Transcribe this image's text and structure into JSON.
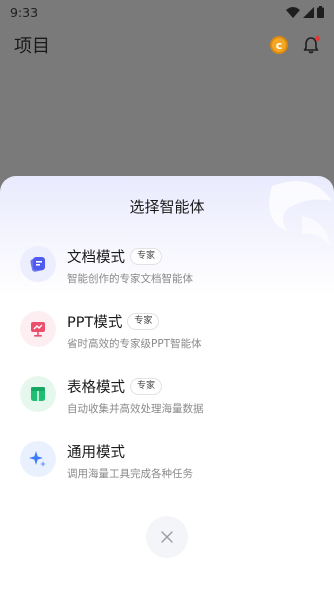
{
  "status_bar": {
    "time": "9:33"
  },
  "app_header": {
    "title": "项目"
  },
  "sheet": {
    "title": "选择智能体",
    "options": [
      {
        "name": "文档模式",
        "badge": "专家",
        "description": "智能创作的专家文档智能体",
        "icon": "document-icon"
      },
      {
        "name": "PPT模式",
        "badge": "专家",
        "description": "省时高效的专家级PPT智能体",
        "icon": "presentation-icon"
      },
      {
        "name": "表格模式",
        "badge": "专家",
        "description": "自动收集并高效处理海量数据",
        "icon": "table-icon"
      },
      {
        "name": "通用模式",
        "badge": "",
        "description": "调用海量工具完成各种任务",
        "icon": "sparkle-icon"
      }
    ],
    "close_icon": "close-icon"
  },
  "colors": {
    "document": "#4f5bef",
    "ppt": "#ec4f6b",
    "table": "#1fbf73",
    "general": "#3d7bfa"
  }
}
